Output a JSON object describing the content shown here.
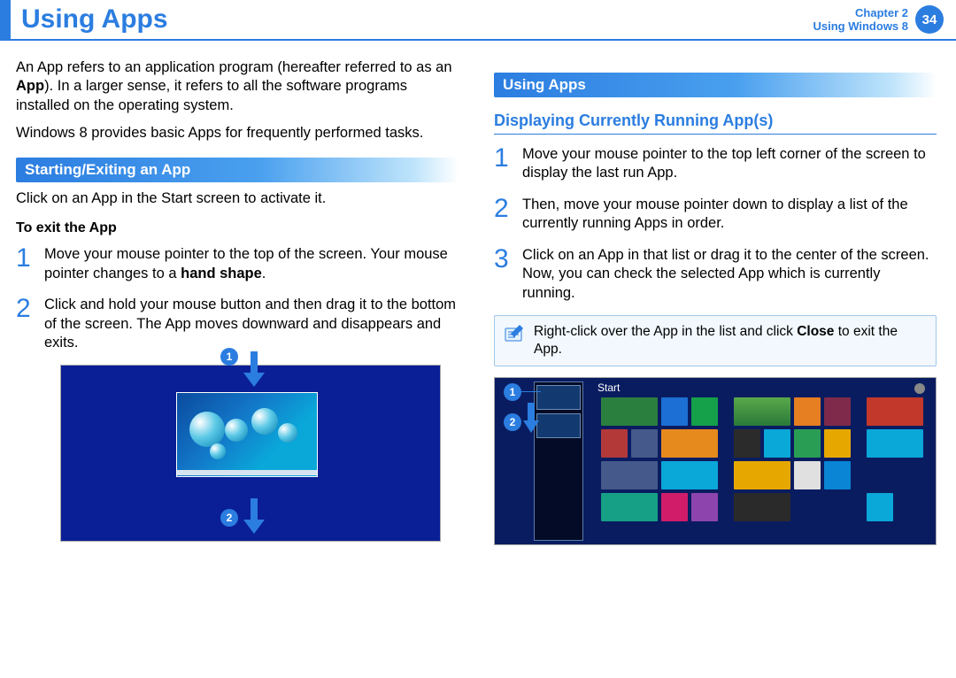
{
  "header": {
    "title": "Using Apps",
    "chapter": "Chapter 2",
    "section": "Using Windows 8",
    "page": "34"
  },
  "left": {
    "intro1a": "An App refers to an application program (hereafter referred to as an ",
    "intro1b": "App",
    "intro1c": "). In a larger sense, it refers to all the software programs installed on the operating system.",
    "intro2": "Windows 8 provides basic Apps for frequently performed tasks.",
    "section_title": "Starting/Exiting an App",
    "click_text": "Click on an App in the Start screen to activate it.",
    "exit_title": "To exit the App",
    "step1a": " Move your mouse pointer to the top of the screen. Your mouse pointer changes to a ",
    "step1b": "hand shape",
    "step1c": ".",
    "step2": "Click and hold your mouse button and then drag it to the bottom of the screen. The App moves downward and disappears and exits.",
    "illus_label1": "1",
    "illus_label2": "2"
  },
  "right": {
    "section_title": "Using Apps",
    "sub_title": "Displaying Currently Running App(s)",
    "step1": "Move your mouse pointer to the top left corner of the screen to display the last run App.",
    "step2": "Then, move your mouse pointer down to display a list of the currently running Apps in order.",
    "step3": "Click on an App in that list or drag it to the center of the screen. Now, you can check the selected App which is currently running.",
    "tip_a": "Right-click over the App in the list and click ",
    "tip_b": "Close",
    "tip_c": " to exit the App.",
    "illus_label1": "1",
    "illus_label2": "2",
    "start_label": "Start"
  }
}
